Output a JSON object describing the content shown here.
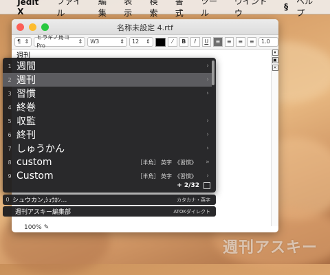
{
  "menubar": {
    "apple": "",
    "app": "Jedit X",
    "items": [
      "ファイル",
      "編集",
      "表示",
      "検索",
      "書式",
      "ツール",
      "ウインドウ"
    ],
    "extra_icon": "evernote-icon",
    "help": "ヘルプ"
  },
  "window": {
    "title": "名称未設定 4.rtf",
    "toolbar": {
      "paragraph": "¶",
      "font": "ヒラギノ角ゴ Pro",
      "weight": "W3",
      "size": "12",
      "bold": "B",
      "italic": "I",
      "underline": "U",
      "spacing": "1.0"
    },
    "document_text": "週刊",
    "zoom": "100%"
  },
  "candidates": [
    {
      "num": "1",
      "word": "週間",
      "info": "",
      "arrow": "›"
    },
    {
      "num": "2",
      "word": "週刊",
      "info": "",
      "arrow": "›"
    },
    {
      "num": "3",
      "word": "習慣",
      "info": "",
      "arrow": "›"
    },
    {
      "num": "4",
      "word": "終巻",
      "info": "",
      "arrow": ""
    },
    {
      "num": "5",
      "word": "収監",
      "info": "",
      "arrow": "›"
    },
    {
      "num": "6",
      "word": "終刊",
      "info": "",
      "arrow": "›"
    },
    {
      "num": "7",
      "word": "しゅうかん",
      "info": "",
      "arrow": "›"
    },
    {
      "num": "8",
      "word": "custom",
      "info": "［半角］ 英字　《習慣》",
      "arrow": "»"
    },
    {
      "num": "9",
      "word": "Custom",
      "info": "［半角］ 英字　《習慣》",
      "arrow": "›"
    }
  ],
  "pager": "+ 2/32",
  "katakana_row": {
    "num": "0",
    "word": "シュウカン,ｼｭｳｶﾝ…",
    "info": "カタカナ・英字"
  },
  "dictionary_row": {
    "word": "週刊アスキー編集部",
    "info": "ATOKダイレクト"
  },
  "watermark": "週刊アスキー"
}
